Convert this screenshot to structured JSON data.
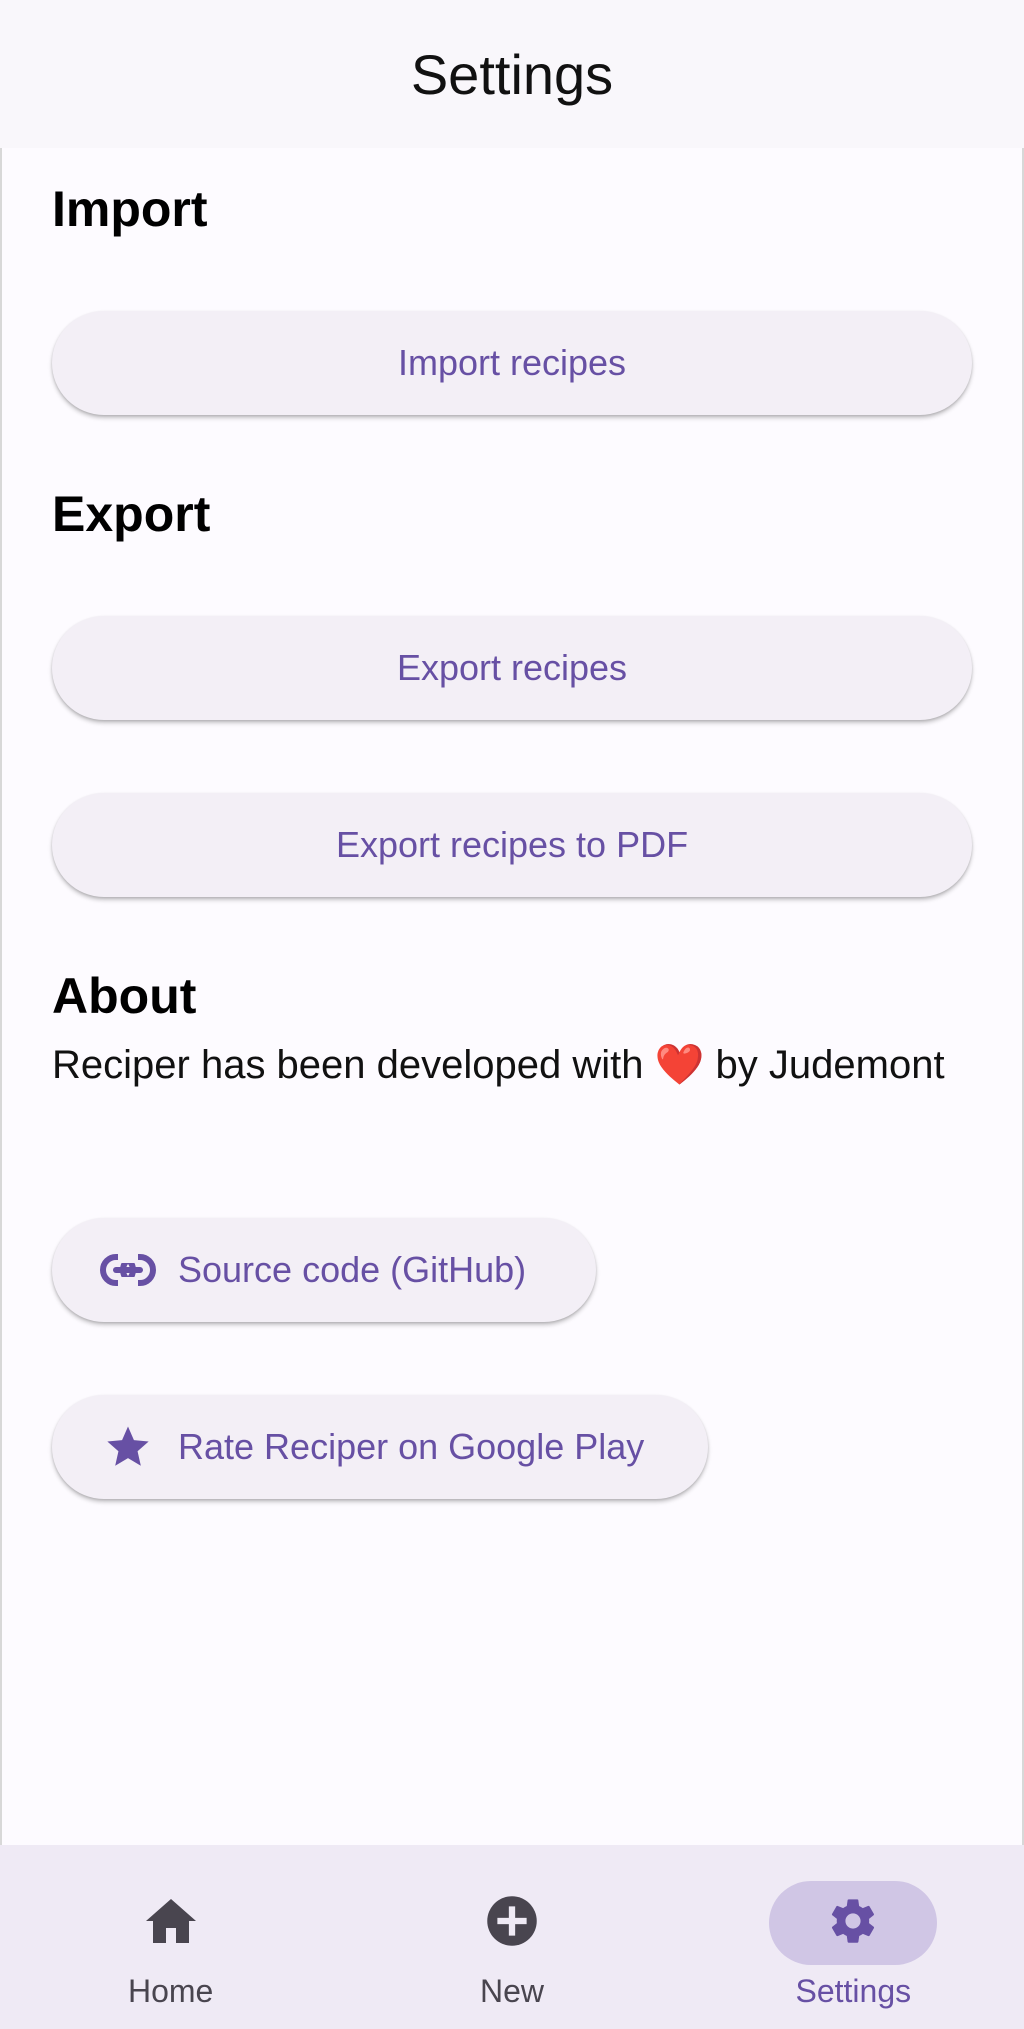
{
  "app_bar": {
    "title": "Settings"
  },
  "sections": {
    "import": {
      "title": "Import",
      "button_label": "Import recipes"
    },
    "export": {
      "title": "Export",
      "button_label": "Export recipes",
      "pdf_button_label": "Export recipes to PDF"
    },
    "about": {
      "title": "About",
      "text_before": "Reciper has been developed with ",
      "heart": "❤️",
      "text_after": " by Judemont",
      "source_code_label": "Source code (GitHub)",
      "source_code_icon": "link-icon",
      "rate_label": "Rate Reciper on Google Play",
      "rate_icon": "star-icon"
    }
  },
  "bottom_nav": {
    "items": [
      {
        "label": "Home",
        "icon": "home-icon",
        "active": false
      },
      {
        "label": "New",
        "icon": "add-circle-icon",
        "active": false
      },
      {
        "label": "Settings",
        "icon": "gear-icon",
        "active": true
      }
    ]
  },
  "colors": {
    "accent": "#6750a4",
    "button_bg": "#f3eff6",
    "nav_bg": "#efeaf5",
    "nav_active_pill": "#d0c6e5",
    "heart": "#e01b24"
  }
}
